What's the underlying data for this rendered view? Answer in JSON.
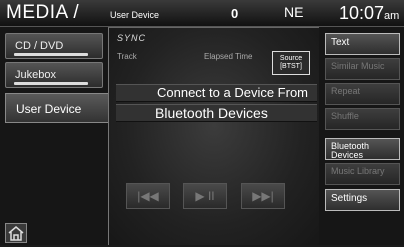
{
  "status": {
    "title": "MEDIA /",
    "subtitle": "User Device",
    "indicator": "0",
    "signal": "NE",
    "time": "10:07",
    "ampm": "am"
  },
  "left_menu": {
    "cd": "CD / DVD",
    "jukebox": "Jukebox",
    "user_device": "User Device"
  },
  "center": {
    "logo": "SYNC",
    "track_label": "Track",
    "elapsed_label": "Elapsed Time",
    "source_label": "Source [BTST]",
    "line1": "Connect to a Device From",
    "line2": "Bluetooth Devices",
    "prev": "|◀◀",
    "playpause": "▶ II",
    "next": "▶▶|"
  },
  "right_menu": {
    "text": "Text",
    "similar": "Similar Music",
    "repeat": "Repeat",
    "shuffle": "Shuffle",
    "bluetooth": "Bluetooth Devices",
    "music_library": "Music Library",
    "settings": "Settings"
  }
}
